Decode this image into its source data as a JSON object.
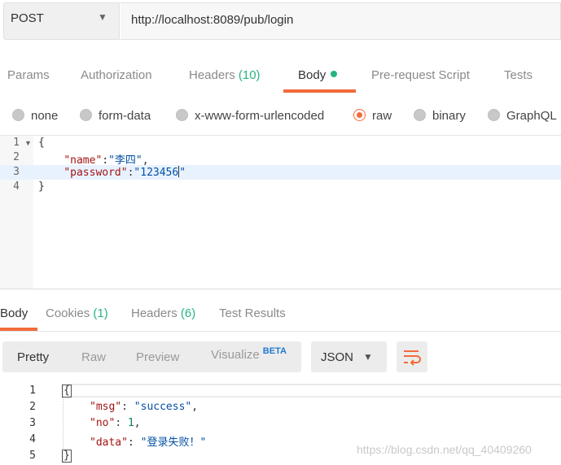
{
  "request": {
    "method": "POST",
    "url": "http://localhost:8089/pub/login"
  },
  "request_tabs": [
    {
      "label": "Params",
      "count": ""
    },
    {
      "label": "Authorization",
      "count": ""
    },
    {
      "label": "Headers",
      "count": "(10)"
    },
    {
      "label": "Body",
      "count": ""
    },
    {
      "label": "Pre-request Script",
      "count": ""
    },
    {
      "label": "Tests",
      "count": ""
    }
  ],
  "body_types": [
    {
      "label": "none",
      "selected": false
    },
    {
      "label": "form-data",
      "selected": false
    },
    {
      "label": "x-www-form-urlencoded",
      "selected": false
    },
    {
      "label": "raw",
      "selected": true
    },
    {
      "label": "binary",
      "selected": false
    },
    {
      "label": "GraphQL",
      "selected": false
    }
  ],
  "request_body": {
    "line_numbers": [
      "1",
      "2",
      "3",
      "4"
    ],
    "open_brace": "{",
    "close_brace": "}",
    "name_key": "\"name\"",
    "name_value": "\"李四\"",
    "password_key": "\"password\"",
    "password_value": "\"123456",
    "password_quote": "\"",
    "colon": ":",
    "comma": ","
  },
  "response_tabs": [
    {
      "label": "Body",
      "count": ""
    },
    {
      "label": "Cookies",
      "count": "(1)"
    },
    {
      "label": "Headers",
      "count": "(6)"
    },
    {
      "label": "Test Results",
      "count": ""
    }
  ],
  "view_modes": {
    "pretty": "Pretty",
    "raw": "Raw",
    "preview": "Preview",
    "visualize": "Visualize",
    "beta": "BETA"
  },
  "format": "JSON",
  "response_body": {
    "line_numbers": [
      "1",
      "2",
      "3",
      "4",
      "5"
    ],
    "open_brace": "{",
    "close_brace": "}",
    "msg_key": "\"msg\"",
    "msg_value": "\"success\"",
    "no_key": "\"no\"",
    "no_value": "1",
    "data_key": "\"data\"",
    "data_value": "\"登录失败！\"",
    "colon": ": ",
    "comma": ","
  },
  "watermark": "https://blog.csdn.net/qq_40409260",
  "colors": {
    "accent": "#f26b3a",
    "count_green": "#26b47f",
    "beta_blue": "#1f79d1"
  }
}
